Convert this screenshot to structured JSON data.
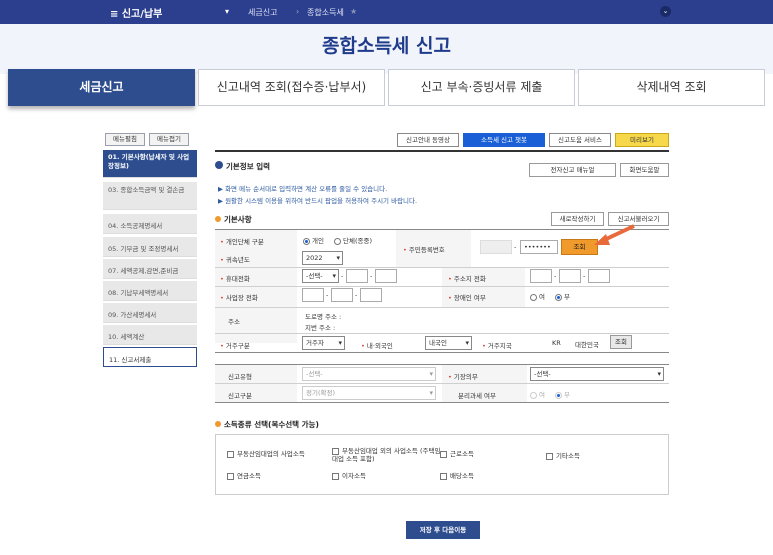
{
  "topnav": {
    "menu": "≡ 신고/납부",
    "crumb1": "세금신고",
    "crumb2": "종합소득세",
    "star": "★",
    "chev": "⌄"
  },
  "page_title": "종합소득세 신고",
  "tabs": [
    "세금신고",
    "신고내역 조회(접수증·납부서)",
    "신고 부속·증빙서류 제출",
    "삭제내역 조회"
  ],
  "side": {
    "expand": "메뉴펼침",
    "collapse": "메뉴접기",
    "items": [
      "01. 기본사항(납세자 및 사업장정보)",
      "03. 종합소득금액 및 결손금",
      "04. 소득공제명세서",
      "05. 기부금 및 조정명세서",
      "07. 세액공제,감면,준비금",
      "08. 기납부세액명세서",
      "09. 가산세명세서",
      "10. 세액계산",
      "11. 신고서제출"
    ]
  },
  "topbtns": {
    "video": "신고안내 동영상",
    "chatbot": "소득세 신고 챗봇",
    "service": "신고도움 서비스",
    "preview": "미리보기"
  },
  "basic": {
    "title": "기본정보 입력",
    "manual": "전자신고 매뉴얼",
    "help": "화면도움말",
    "note1": "▶ 화면 메뉴 순서대로 입력하면 계산 오류를 줄일 수 있습니다.",
    "note2": "▶ 원활한 시스템 이용을 위하여 반드시 팝업을 허용하여 주시기 바랍니다."
  },
  "section1": {
    "title": "기본사항",
    "new": "새로작성하기",
    "load": "신고서불러오기"
  },
  "form": {
    "person_label": "개인단체 구분",
    "person_opt1": "개인",
    "person_opt2": "단체(종중)",
    "rrn_label": "주민등록번호",
    "rrn_dash": "-",
    "rrn_mask": "•••••••",
    "inquire": "조회",
    "year_label": "귀속년도",
    "year_value": "2022",
    "mobile_label": "휴대전화",
    "mobile_select": "-선택-",
    "dash": "-",
    "home_label": "주소지 전화",
    "biz_label": "사업장 전화",
    "disabled_label": "장애인 여부",
    "yes": "여",
    "no": "부",
    "addr_label": "주소",
    "road": "도로명 주소 :",
    "lot": "지번 주소 :",
    "res_label": "거주구분",
    "res_value": "거주자",
    "nat_label": "내·외국인",
    "nat_value": "내국인",
    "country_label": "거주지국",
    "country_code": "KR",
    "country_name": "대한민국",
    "country_btn": "조회"
  },
  "section2": {
    "type_label": "신고유형",
    "type_value": "-선택-",
    "book_label": "기장의무",
    "book_value": "-선택-",
    "kind_label": "신고구분",
    "kind_value": "정기(확정)",
    "sep_label": "분리과세 여부",
    "yes": "여",
    "no": "부"
  },
  "income": {
    "title": "소득종류 선택(복수선택 가능)",
    "items": [
      "부동산임대업의 사업소득",
      "부동산임대업 외의 사업소득 (주택임대업 소득 포함)",
      "근로소득",
      "기타소득",
      "연금소득",
      "이자소득",
      "배당소득"
    ]
  },
  "save": "저장 후 다음이동",
  "colors": {
    "navy": "#2c3f8f",
    "accent": "#f19a2c",
    "tab_active": "#2d4d8f"
  }
}
